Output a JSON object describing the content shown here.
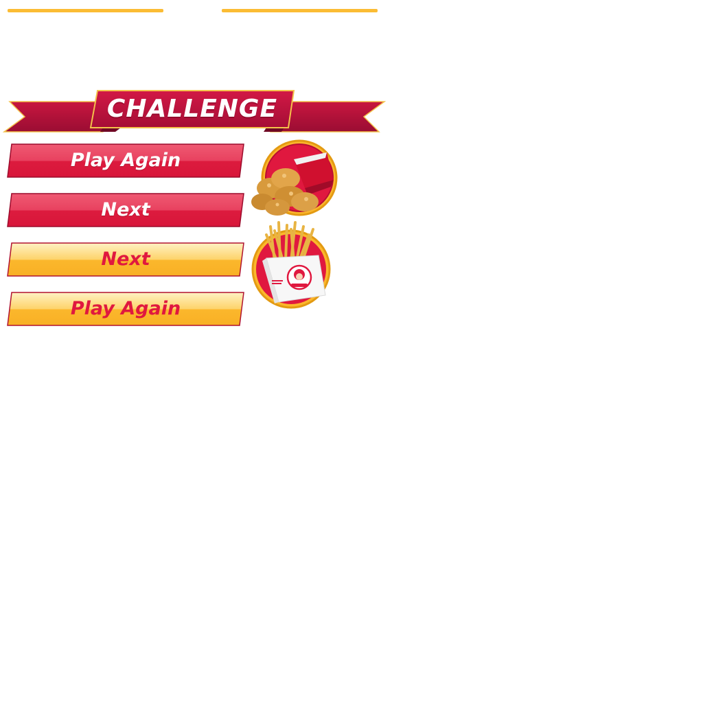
{
  "banner": {
    "title": "CHALLENGE"
  },
  "buttons": [
    {
      "label": "Play Again",
      "style": "red"
    },
    {
      "label": "Next",
      "style": "red"
    },
    {
      "label": "Next",
      "style": "yellow"
    },
    {
      "label": "Play Again",
      "style": "yellow"
    }
  ],
  "prizes": [
    {
      "name": "chicken-nuggets-icon"
    },
    {
      "name": "french-fries-icon"
    }
  ],
  "colors": {
    "accent_yellow": "#fbbc34",
    "brand_red": "#e0183f",
    "banner_red": "#b5123c",
    "white": "#ffffff"
  }
}
